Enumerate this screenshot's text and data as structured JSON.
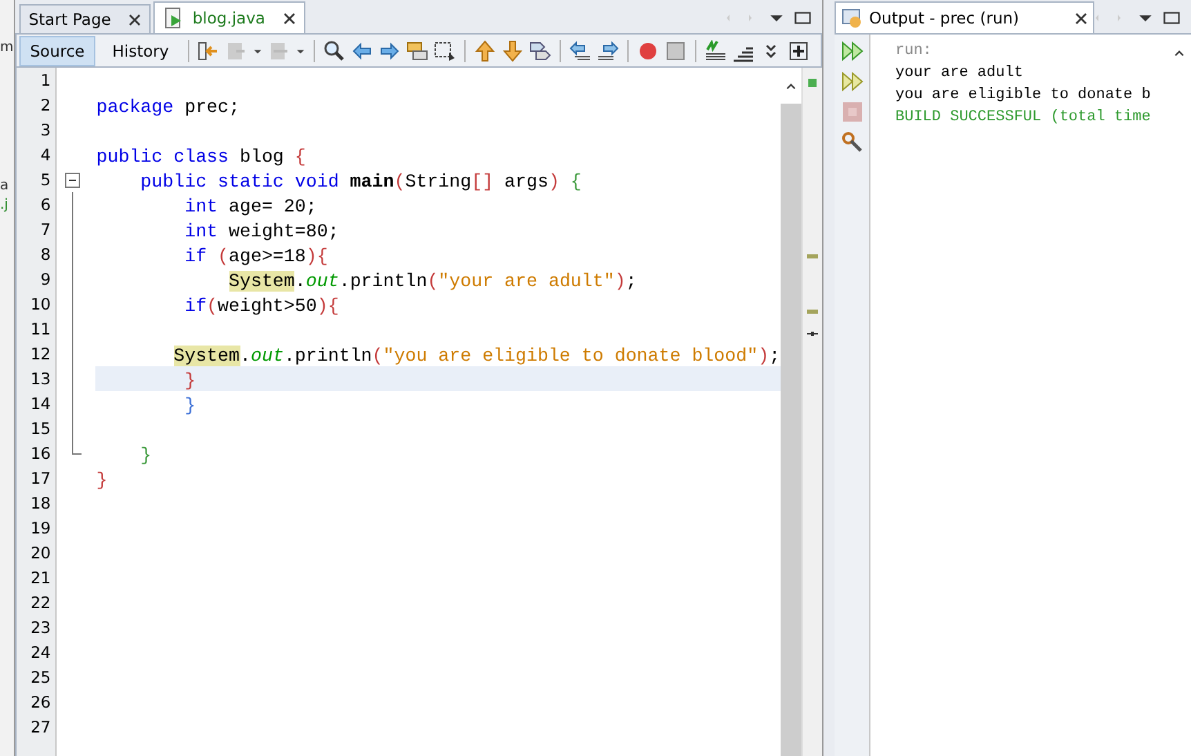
{
  "left_panel": {
    "fragments": [
      "m",
      "a",
      ".j"
    ]
  },
  "editor_tabs": [
    {
      "label": "Start Page",
      "selected": false
    },
    {
      "label": "blog.java",
      "selected": true
    }
  ],
  "view_tabs": [
    {
      "label": "Source",
      "selected": true
    },
    {
      "label": "History",
      "selected": false
    }
  ],
  "code_lines": [
    {
      "number": "1",
      "current": false,
      "kind": "plain"
    },
    {
      "number": "2",
      "current": false,
      "kind": "plain",
      "tokens": [
        {
          "kind": "kw",
          "text": "package"
        },
        {
          "kind": "txt",
          "text": " prec;"
        }
      ]
    },
    {
      "number": "3",
      "current": false,
      "kind": "plain"
    },
    {
      "number": "4",
      "current": false,
      "kind": "plain",
      "tokens": [
        {
          "kind": "kw",
          "text": "public class"
        },
        {
          "kind": "txt",
          "text": " blog "
        },
        {
          "kind": "paren",
          "text": "{"
        }
      ]
    },
    {
      "number": "5",
      "current": false,
      "kind": "fold_start",
      "tokens": [
        {
          "kind": "kw",
          "text": "    public static void"
        },
        {
          "kind": "bold",
          "text": " main"
        },
        {
          "kind": "paren",
          "text": "("
        },
        {
          "kind": "txt",
          "text": "String"
        },
        {
          "kind": "paren",
          "text": "[]"
        },
        {
          "kind": "txt",
          "text": " args"
        },
        {
          "kind": "paren",
          "text": ")"
        },
        {
          "kind": "brace",
          "text": " {"
        }
      ]
    },
    {
      "number": "6",
      "current": false,
      "kind": "fold_line",
      "tokens": [
        {
          "kind": "kw",
          "text": "        int"
        },
        {
          "kind": "txt",
          "text": " age= 20;"
        }
      ]
    },
    {
      "number": "7",
      "current": false,
      "kind": "fold_line",
      "tokens": [
        {
          "kind": "kw",
          "text": "        int"
        },
        {
          "kind": "txt",
          "text": " weight=80;"
        }
      ]
    },
    {
      "number": "8",
      "current": false,
      "kind": "fold_line",
      "tokens": [
        {
          "kind": "kw",
          "text": "        if"
        },
        {
          "kind": "paren",
          "text": " ("
        },
        {
          "kind": "txt",
          "text": "age>=18"
        },
        {
          "kind": "paren",
          "text": "){"
        }
      ]
    },
    {
      "number": "9",
      "current": false,
      "kind": "fold_line",
      "tokens": [
        {
          "kind": "mark",
          "text": "            System"
        },
        {
          "kind": "txt",
          "text": "."
        },
        {
          "kind": "field",
          "text": "out"
        },
        {
          "kind": "txt",
          "text": ".println"
        },
        {
          "kind": "paren",
          "text": "("
        },
        {
          "kind": "str",
          "text": "\"your are adult\""
        },
        {
          "kind": "paren",
          "text": ")"
        },
        {
          "kind": "txt",
          "text": ";"
        }
      ]
    },
    {
      "number": "10",
      "current": false,
      "kind": "fold_line",
      "tokens": [
        {
          "kind": "kw",
          "text": "        if"
        },
        {
          "kind": "paren",
          "text": "("
        },
        {
          "kind": "txt",
          "text": "weight>50"
        },
        {
          "kind": "paren",
          "text": "){"
        }
      ]
    },
    {
      "number": "11",
      "current": false,
      "kind": "fold_line"
    },
    {
      "number": "12",
      "current": false,
      "kind": "fold_line",
      "tokens": [
        {
          "kind": "mark",
          "text": "       System"
        },
        {
          "kind": "txt",
          "text": "."
        },
        {
          "kind": "field",
          "text": "out"
        },
        {
          "kind": "txt",
          "text": ".println"
        },
        {
          "kind": "paren",
          "text": "("
        },
        {
          "kind": "str",
          "text": "\"you are eligible to donate blood\""
        },
        {
          "kind": "paren",
          "text": ")"
        },
        {
          "kind": "txt",
          "text": ";"
        }
      ]
    },
    {
      "number": "13",
      "current": true,
      "kind": "fold_line",
      "tokens": [
        {
          "kind": "paren",
          "text": "        }"
        }
      ]
    },
    {
      "number": "14",
      "current": false,
      "kind": "fold_line",
      "tokens": [
        {
          "kind": "bluebrace",
          "text": "        }"
        }
      ]
    },
    {
      "number": "15",
      "current": false,
      "kind": "fold_line"
    },
    {
      "number": "16",
      "current": false,
      "kind": "fold_end",
      "tokens": [
        {
          "kind": "brace",
          "text": "    }"
        }
      ]
    },
    {
      "number": "17",
      "current": false,
      "kind": "plain",
      "tokens": [
        {
          "kind": "paren",
          "text": "}"
        }
      ]
    },
    {
      "number": "18",
      "current": false,
      "kind": "plain"
    },
    {
      "number": "19",
      "current": false,
      "kind": "plain"
    },
    {
      "number": "20",
      "current": false,
      "kind": "plain"
    },
    {
      "number": "21",
      "current": false,
      "kind": "plain"
    },
    {
      "number": "22",
      "current": false,
      "kind": "plain"
    },
    {
      "number": "23",
      "current": false,
      "kind": "plain"
    },
    {
      "number": "24",
      "current": false,
      "kind": "plain"
    },
    {
      "number": "25",
      "current": false,
      "kind": "plain"
    },
    {
      "number": "26",
      "current": false,
      "kind": "plain"
    },
    {
      "number": "27",
      "current": false,
      "kind": "plain"
    }
  ],
  "output": {
    "title": "Output - prec (run)",
    "lines": [
      {
        "kind": "muted",
        "text": "run:"
      },
      {
        "kind": "normal",
        "text": "your are adult"
      },
      {
        "kind": "normal",
        "text": "you are eligible to donate b"
      },
      {
        "kind": "success",
        "text": "BUILD SUCCESSFUL (total time"
      }
    ]
  }
}
